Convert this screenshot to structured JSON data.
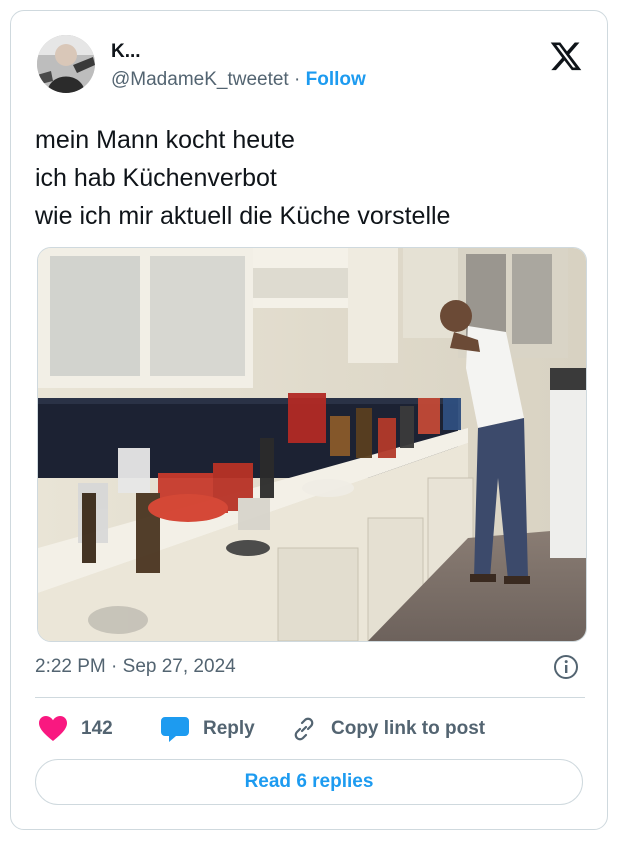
{
  "author": {
    "display_name": "K...",
    "handle": "@MadameK_tweetet",
    "separator": "·",
    "follow_label": "Follow"
  },
  "tweet": {
    "lines": [
      "mein Mann kocht heute",
      "ich hab Küchenverbot",
      "wie ich mir aktuell die Küche vorstelle"
    ]
  },
  "meta": {
    "time": "2:22 PM",
    "separator": "·",
    "date": "Sep 27, 2024"
  },
  "actions": {
    "like_count": "142",
    "reply_label": "Reply",
    "copy_link_label": "Copy link to post"
  },
  "footer": {
    "read_replies_label": "Read 6 replies"
  },
  "icons": {
    "like": "heart-icon",
    "reply": "speech-bubble-icon",
    "copy_link": "link-icon",
    "info": "info-icon",
    "brand": "x-logo-icon"
  },
  "colors": {
    "like": "#f91880",
    "reply_bubble": "#1d9bf0",
    "follow": "#1d9bf0",
    "secondary_text": "#536471"
  }
}
